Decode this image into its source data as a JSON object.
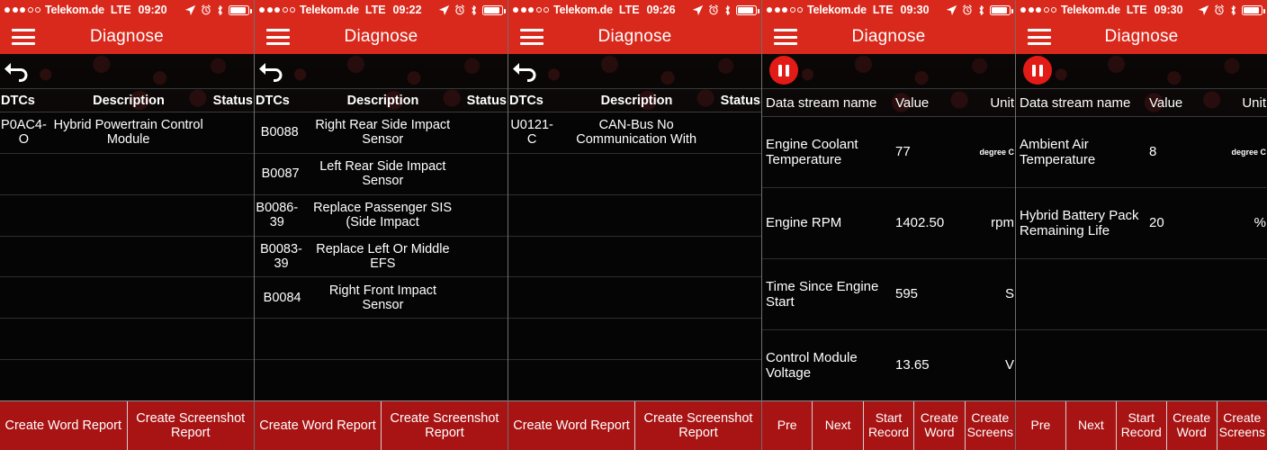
{
  "app": {
    "title": "Diagnose"
  },
  "status_bar": {
    "carrier": "Telekom.de",
    "network": "LTE",
    "signal_filled": 3,
    "signal_empty": 2,
    "icons": [
      "location-arrow-icon",
      "alarm-clock-icon",
      "bluetooth-icon",
      "battery-icon"
    ]
  },
  "colors": {
    "accent_red": "#d9291c",
    "button_red": "#a81414",
    "pause_red": "#e31b17",
    "background": "#050505",
    "text": "#ffffff"
  },
  "panels": [
    {
      "id": "panel-1",
      "kind": "dtc",
      "time": "09:20",
      "nav_title": "Diagnose",
      "left_control": "back-arrow-icon",
      "columns": [
        "DTCs",
        "Description",
        "Status"
      ],
      "rows": [
        {
          "code": "P0AC4-O",
          "description": "Hybrid Powertrain Control Module",
          "status": ""
        },
        {
          "code": "",
          "description": "",
          "status": ""
        },
        {
          "code": "",
          "description": "",
          "status": ""
        },
        {
          "code": "",
          "description": "",
          "status": ""
        },
        {
          "code": "",
          "description": "",
          "status": ""
        },
        {
          "code": "",
          "description": "",
          "status": ""
        },
        {
          "code": "",
          "description": "",
          "status": ""
        }
      ],
      "buttons": [
        "Create Word Report",
        "Create Screenshot Report"
      ]
    },
    {
      "id": "panel-2",
      "kind": "dtc",
      "time": "09:22",
      "nav_title": "Diagnose",
      "left_control": "back-arrow-icon",
      "columns": [
        "DTCs",
        "Description",
        "Status"
      ],
      "rows": [
        {
          "code": "B0088",
          "description": "Right Rear Side Impact Sensor",
          "status": ""
        },
        {
          "code": "B0087",
          "description": "Left Rear Side Impact Sensor",
          "status": ""
        },
        {
          "code": "B0086-39",
          "description": "Replace Passenger SIS (Side Impact",
          "status": ""
        },
        {
          "code": "B0083-39",
          "description": "Replace Left Or Middle EFS",
          "status": ""
        },
        {
          "code": "B0084",
          "description": "Right Front Impact Sensor",
          "status": ""
        },
        {
          "code": "",
          "description": "",
          "status": ""
        },
        {
          "code": "",
          "description": "",
          "status": ""
        }
      ],
      "buttons": [
        "Create Word Report",
        "Create Screenshot Report"
      ]
    },
    {
      "id": "panel-3",
      "kind": "dtc",
      "time": "09:26",
      "nav_title": "Diagnose",
      "left_control": "back-arrow-icon",
      "columns": [
        "DTCs",
        "Description",
        "Status"
      ],
      "rows": [
        {
          "code": "U0121-C",
          "description": "CAN-Bus No Communication With",
          "status": ""
        },
        {
          "code": "",
          "description": "",
          "status": ""
        },
        {
          "code": "",
          "description": "",
          "status": ""
        },
        {
          "code": "",
          "description": "",
          "status": ""
        },
        {
          "code": "",
          "description": "",
          "status": ""
        },
        {
          "code": "",
          "description": "",
          "status": ""
        },
        {
          "code": "",
          "description": "",
          "status": ""
        }
      ],
      "buttons": [
        "Create Word Report",
        "Create Screenshot Report"
      ]
    },
    {
      "id": "panel-4",
      "kind": "datastream",
      "time": "09:30",
      "nav_title": "Diagnose",
      "left_control": "pause-icon",
      "columns": [
        "Data stream name",
        "Value",
        "Unit"
      ],
      "rows": [
        {
          "name": "Engine Coolant Temperature",
          "value": "77",
          "unit": "degree C",
          "unit_small": true
        },
        {
          "name": "Engine RPM",
          "value": "1402.50",
          "unit": "rpm",
          "unit_small": false
        },
        {
          "name": "Time Since Engine Start",
          "value": "595",
          "unit": "S",
          "unit_small": false
        },
        {
          "name": "Control Module Voltage",
          "value": "13.65",
          "unit": "V",
          "unit_small": false
        }
      ],
      "buttons": [
        "Pre",
        "Next",
        "Start Record",
        "Create Word",
        "Create Screens"
      ]
    },
    {
      "id": "panel-5",
      "kind": "datastream",
      "time": "09:30",
      "nav_title": "Diagnose",
      "left_control": "pause-icon",
      "columns": [
        "Data stream name",
        "Value",
        "Unit"
      ],
      "rows": [
        {
          "name": "Ambient Air Temperature",
          "value": "8",
          "unit": "degree C",
          "unit_small": true
        },
        {
          "name": "Hybrid Battery Pack Remaining Life",
          "value": "20",
          "unit": "%",
          "unit_small": false
        },
        {
          "name": "",
          "value": "",
          "unit": "",
          "unit_small": false
        },
        {
          "name": "",
          "value": "",
          "unit": "",
          "unit_small": false
        }
      ],
      "buttons": [
        "Pre",
        "Next",
        "Start Record",
        "Create Word",
        "Create Screens"
      ]
    }
  ]
}
